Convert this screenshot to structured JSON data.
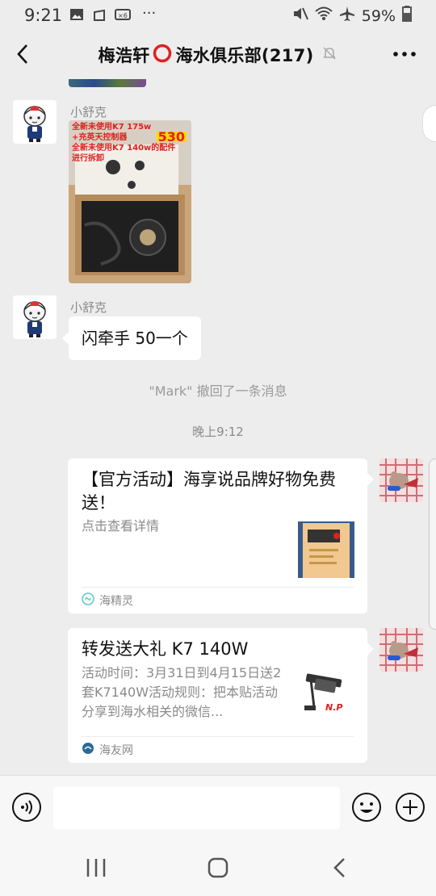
{
  "status": {
    "time": "9:21",
    "battery": "59%"
  },
  "header": {
    "title_prefix": "梅浩轩",
    "title_suffix": "海水俱乐部(217)"
  },
  "messages": {
    "m1_sender": "小舒克",
    "m1_image_caption_lines": [
      "全新未使用K7 175w",
      "+充英天控制器",
      "530",
      "全新未使用K7 140w的配件",
      "进行拆卸"
    ],
    "m2_sender": "小舒克",
    "m2_text": "闪牵手 50一个",
    "recall_notice": "\"Mark\" 撤回了一条消息",
    "timestamp": "晚上9:12",
    "card1": {
      "title": "【官方活动】海享说品牌好物免费送！",
      "desc": "点击查看详情",
      "source": "海精灵"
    },
    "card2": {
      "title": "转发送大礼 K7 140W",
      "desc": "活动时间：3月31日到4月15日送2套K7140W活动规则：把本贴活动分享到海水相关的微信...",
      "source": "海友网"
    }
  },
  "input": {
    "placeholder": ""
  },
  "colors": {
    "background": "#ededed",
    "bubble": "#ffffff",
    "muted_text": "#8a8a8a",
    "circle_icon": "#e02020"
  }
}
